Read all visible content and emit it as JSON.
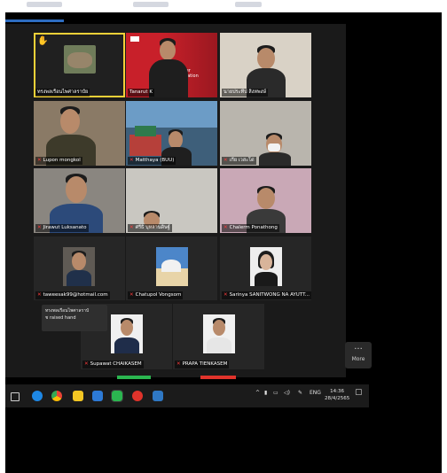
{
  "participants": [
    {
      "name": "ทรงพลเรือนไพศาลราบัย",
      "raised_hand": true
    },
    {
      "name": "Tanarut K",
      "muted": false
    },
    {
      "name": "นายประทีป สิงหพงษ์",
      "muted": false
    },
    {
      "name": "Lupon mongkol",
      "muted": true
    },
    {
      "name": "Matthaya (BUU)",
      "muted": true
    },
    {
      "name": "เกีย เวสะโด่",
      "muted": true
    },
    {
      "name": "Jirawut Luksanato",
      "muted": true
    },
    {
      "name": "ศรีธิ บุหลานดิษฐ์",
      "muted": true
    },
    {
      "name": "Chalerm Ponathong",
      "muted": true
    },
    {
      "name": "taweesak99@hotmail.com",
      "muted": true
    },
    {
      "name": "Chatupol Vongsom",
      "muted": true
    },
    {
      "name": "Sarinya SANITWONG NA AYUTT...",
      "muted": true
    },
    {
      "name": "Supawat CHAIKASEM",
      "muted": true
    },
    {
      "name": "PRAPA TIENKASEM",
      "muted": true
    }
  ],
  "tooltip": {
    "line1": "ทรงพลเรือนไพศาลราบั",
    "line2": "ช raised hand"
  },
  "more_button": {
    "label": "More",
    "icon": "ellipsis-icon"
  },
  "presentation_slide": {
    "line1": "igher",
    "line2": "ducation"
  },
  "taskbar": {
    "language": "ENG",
    "time": "14:36",
    "date": "28/4/2565"
  },
  "colors": {
    "active_speaker_border": "#f3d138",
    "mute_icon": "#ff3b3b",
    "share_green": "#2bb650",
    "share_red": "#e0332b"
  }
}
